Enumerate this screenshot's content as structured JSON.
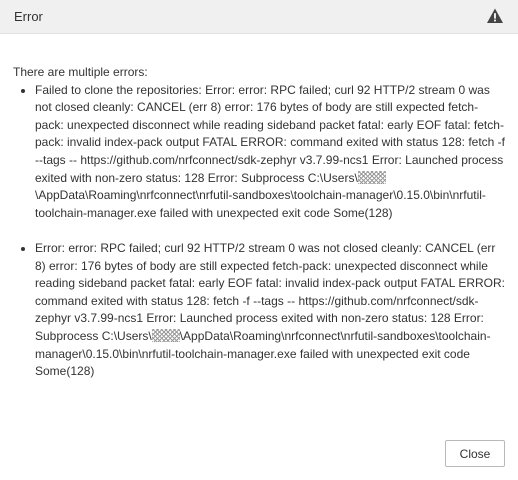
{
  "dialog": {
    "title": "Error",
    "intro": "There are multiple errors:",
    "errors": [
      {
        "before": "Failed to clone the repositories: Error: error: RPC failed; curl 92 HTTP/2 stream 0 was not closed cleanly: CANCEL (err 8) error: 176 bytes of body are still expected fetch-pack: unexpected disconnect while reading sideband packet fatal: early EOF fatal: fetch-pack: invalid index-pack output FATAL ERROR: command exited with status 128: fetch -f --tags -- https://github.com/nrfconnect/sdk-zephyr v3.7.99-ncs1 Error: Launched process exited with non-zero status: 128 Error: Subprocess C:\\Users\\",
        "after": "\\AppData\\Roaming\\nrfconnect\\nrfutil-sandboxes\\toolchain-manager\\0.15.0\\bin\\nrfutil-toolchain-manager.exe failed with unexpected exit code Some(128)"
      },
      {
        "before": "Error: error: RPC failed; curl 92 HTTP/2 stream 0 was not closed cleanly: CANCEL (err 8) error: 176 bytes of body are still expected fetch-pack: unexpected disconnect while reading sideband packet fatal: early EOF fatal: invalid index-pack output FATAL ERROR: command exited with status 128: fetch -f --tags -- https://github.com/nrfconnect/sdk-zephyr v3.7.99-ncs1 Error: Launched process exited with non-zero status: 128 Error: Subprocess C:\\Users\\",
        "after": "\\AppData\\Roaming\\nrfconnect\\nrfutil-sandboxes\\toolchain-manager\\0.15.0\\bin\\nrfutil-toolchain-manager.exe failed with unexpected exit code Some(128)"
      }
    ],
    "close_label": "Close"
  },
  "icons": {
    "header": "warning-icon",
    "redaction": "redacted-username"
  },
  "colors": {
    "header_bg": "#f0f0f0",
    "text": "#333333",
    "button_border": "#b9b9b9"
  }
}
